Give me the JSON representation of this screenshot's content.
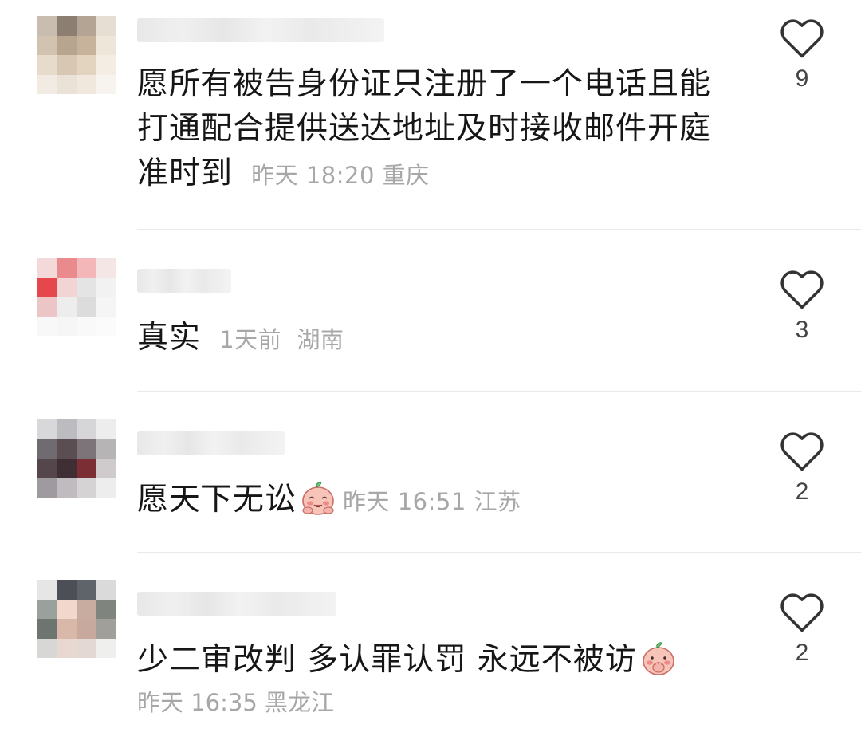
{
  "comments": [
    {
      "text": "愿所有被告身份证只注册了一个电话且能打通配合提供送达地址及时接收邮件开庭准时到",
      "time": "昨天 18:20",
      "location": "重庆",
      "likes": "9",
      "avatar_colors": [
        "#c9bdb0",
        "#8c7f72",
        "#b3a493",
        "#e6ddd3",
        "#d2c3b0",
        "#b8a58f",
        "#c7b39b",
        "#efe6da",
        "#e7dccb",
        "#d8c8b3",
        "#e3d4bf",
        "#f4ede4",
        "#f1ebe3",
        "#eae2d6",
        "#f0e8dd",
        "#f7f3ee"
      ]
    },
    {
      "text": "真实",
      "time": "1天前",
      "location": "湖南",
      "likes": "3",
      "avatar_colors": [
        "#f4d9da",
        "#e98a8d",
        "#f3b7b9",
        "#f5e6e6",
        "#e5474d",
        "#f3d4d4",
        "#e4e4e4",
        "#f2f2f2",
        "#ecc6c6",
        "#ededed",
        "#dcdcdc",
        "#f5f5f5",
        "#f8f8f8",
        "#f6f6f6",
        "#f9f9f9",
        "#fbfbfb"
      ]
    },
    {
      "text": "愿天下无讼",
      "emoji": "peach-smile-emoji",
      "time": "昨天 16:51",
      "location": "江苏",
      "likes": "2",
      "avatar_colors": [
        "#d8d8da",
        "#bcbcc0",
        "#d6d6d8",
        "#ededee",
        "#6f6b70",
        "#5a4e53",
        "#7d7479",
        "#b7b4b6",
        "#55464b",
        "#3f2e33",
        "#7c2e35",
        "#cfcacb",
        "#9f9aa0",
        "#c0bbbf",
        "#d6d3d5",
        "#eeeded"
      ]
    },
    {
      "text": "少二审改判 多认罪认罚 永远不被访",
      "emoji": "peach-hand-emoji",
      "time": "昨天 16:35",
      "location": "黑龙江",
      "likes": "2",
      "avatar_colors": [
        "#e6e6e6",
        "#4c4f55",
        "#5f646a",
        "#dadada",
        "#9aa09c",
        "#f1d7cc",
        "#c9aca0",
        "#7f847e",
        "#6e7470",
        "#d9b8aa",
        "#c7a99d",
        "#a09f99",
        "#d7d7d5",
        "#e8d8d1",
        "#e3d8d3",
        "#efefee"
      ]
    }
  ]
}
